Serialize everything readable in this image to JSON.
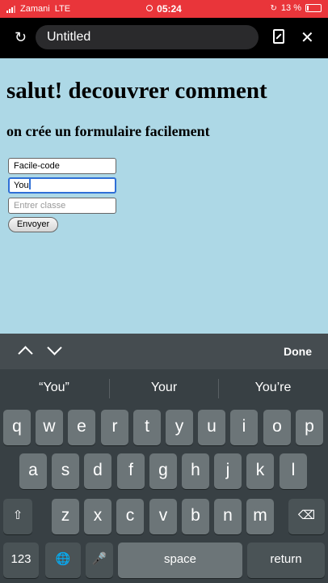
{
  "status_bar": {
    "carrier": "Zamani",
    "network": "LTE",
    "time": "05:24",
    "battery": "13 %",
    "battery_level": 0.13
  },
  "browser": {
    "page_title": "Untitled"
  },
  "page": {
    "heading": "salut! decouvrer comment",
    "subheading": "on crée un formulaire facilement",
    "fields": [
      {
        "value": "Facile-code"
      },
      {
        "value": "You"
      },
      {
        "placeholder": "Entrer classe"
      }
    ],
    "submit_label": "Envoyer"
  },
  "keyboard": {
    "done_label": "Done",
    "suggestions": [
      "“You”",
      "Your",
      "You’re"
    ],
    "row1": [
      "q",
      "w",
      "e",
      "r",
      "t",
      "y",
      "u",
      "i",
      "o",
      "p"
    ],
    "row2": [
      "a",
      "s",
      "d",
      "f",
      "g",
      "h",
      "j",
      "k",
      "l"
    ],
    "row3": [
      "z",
      "x",
      "c",
      "v",
      "b",
      "n",
      "m"
    ],
    "numbers_label": "123",
    "space_label": "space",
    "return_label": "return"
  }
}
